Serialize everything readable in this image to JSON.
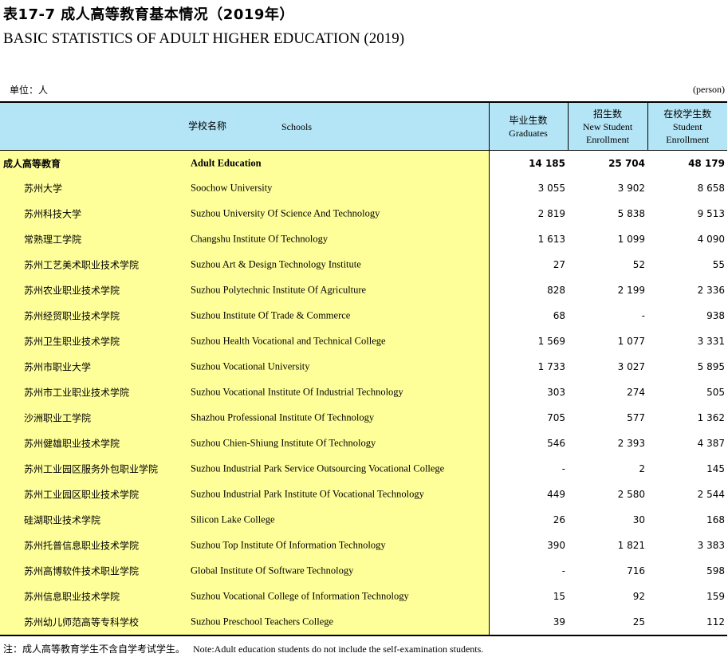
{
  "title_cn": "表17-7  成人高等教育基本情况（2019年）",
  "title_en": "BASIC STATISTICS OF ADULT HIGHER EDUCATION (2019)",
  "unit_left": "单位：人",
  "unit_right": "(person)",
  "table": {
    "headers": {
      "schools_cn": "学校名称",
      "schools_en": "Schools",
      "graduates_cn": "毕业生数",
      "graduates_en": "Graduates",
      "new_cn": "招生数",
      "new_en1": "New Student",
      "new_en2": "Enrollment",
      "enrolled_cn": "在校学生数",
      "enrolled_en1": "Student",
      "enrolled_en2": "Enrollment"
    },
    "rows": [
      {
        "cn": "成人高等教育",
        "en": "Adult Education",
        "graduates": "14 185",
        "new": "25 704",
        "enrolled": "48 179"
      },
      {
        "cn": "苏州大学",
        "en": "Soochow University",
        "graduates": "3 055",
        "new": "3 902",
        "enrolled": "8 658"
      },
      {
        "cn": "苏州科技大学",
        "en": "Suzhou University Of Science And Technology",
        "graduates": "2 819",
        "new": "5 838",
        "enrolled": "9 513"
      },
      {
        "cn": "常熟理工学院",
        "en": "Changshu Institute Of Technology",
        "graduates": "1 613",
        "new": "1 099",
        "enrolled": "4 090"
      },
      {
        "cn": "苏州工艺美术职业技术学院",
        "en": "Suzhou Art & Design Technology Institute",
        "graduates": "27",
        "new": "52",
        "enrolled": "55"
      },
      {
        "cn": "苏州农业职业技术学院",
        "en": "Suzhou Polytechnic Institute Of Agriculture",
        "graduates": "828",
        "new": "2 199",
        "enrolled": "2 336"
      },
      {
        "cn": "苏州经贸职业技术学院",
        "en": "Suzhou Institute Of Trade & Commerce",
        "graduates": "68",
        "new": "-",
        "enrolled": "938"
      },
      {
        "cn": "苏州卫生职业技术学院",
        "en": "Suzhou Health Vocational and Technical College",
        "graduates": "1 569",
        "new": "1 077",
        "enrolled": "3 331"
      },
      {
        "cn": "苏州市职业大学",
        "en": "Suzhou Vocational University",
        "graduates": "1 733",
        "new": "3 027",
        "enrolled": "5 895"
      },
      {
        "cn": "苏州市工业职业技术学院",
        "en": "Suzhou Vocational Institute Of Industrial Technology",
        "graduates": "303",
        "new": "274",
        "enrolled": "505"
      },
      {
        "cn": "沙洲职业工学院",
        "en": "Shazhou Professional Institute Of Technology",
        "graduates": "705",
        "new": "577",
        "enrolled": "1 362"
      },
      {
        "cn": "苏州健雄职业技术学院",
        "en": "Suzhou Chien-Shiung Institute  Of  Technology",
        "graduates": "546",
        "new": "2 393",
        "enrolled": "4 387"
      },
      {
        "cn": "苏州工业园区服务外包职业学院",
        "en": "Suzhou Industrial Park Service Outsourcing Vocational College",
        "graduates": "-",
        "new": "2",
        "enrolled": "145"
      },
      {
        "cn": "苏州工业园区职业技术学院",
        "en": "Suzhou Industrial Park Institute Of Vocational Technology",
        "graduates": "449",
        "new": "2 580",
        "enrolled": "2 544"
      },
      {
        "cn": "硅湖职业技术学院",
        "en": "Silicon Lake College",
        "graduates": "26",
        "new": "30",
        "enrolled": "168"
      },
      {
        "cn": "苏州托普信息职业技术学院",
        "en": "Suzhou Top Institute Of Information Technology",
        "graduates": "390",
        "new": "1 821",
        "enrolled": "3 383"
      },
      {
        "cn": "苏州高博软件技术职业学院",
        "en": "Global Institute Of Software Technology",
        "graduates": "-",
        "new": "716",
        "enrolled": "598"
      },
      {
        "cn": "苏州信息职业技术学院",
        "en": "Suzhou Vocational College of Information Technology",
        "graduates": "15",
        "new": "92",
        "enrolled": "159"
      },
      {
        "cn": "苏州幼儿师范高等专科学校",
        "en": "Suzhou Preschool Teachers College",
        "graduates": "39",
        "new": "25",
        "enrolled": "112"
      }
    ]
  },
  "note_cn": "注：成人高等教育学生不含自学考试学生。",
  "note_en": "Note:Adult education students do not include the self-examination students.",
  "colors": {
    "header_bg": "#b4e5f7",
    "name_col_bg": "#ffff99"
  }
}
